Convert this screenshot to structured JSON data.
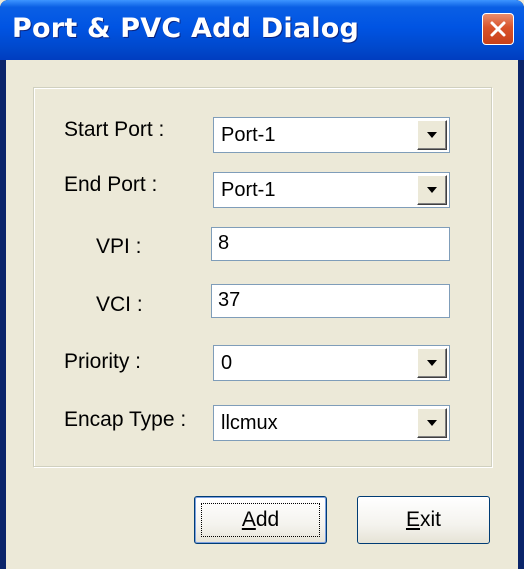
{
  "window": {
    "title": "Port & PVC Add Dialog"
  },
  "form": {
    "start_port": {
      "label": "Start Port :",
      "value": "Port-1"
    },
    "end_port": {
      "label": "End Port :",
      "value": "Port-1"
    },
    "vpi": {
      "label": "VPI :",
      "value": "8"
    },
    "vci": {
      "label": "VCI :",
      "value": "37"
    },
    "priority": {
      "label": "Priority :",
      "value": "0"
    },
    "encap_type": {
      "label": "Encap Type :",
      "value": "llcmux"
    }
  },
  "buttons": {
    "add": {
      "label": "Add",
      "mnemonic": "A",
      "rest": "dd"
    },
    "exit": {
      "label": "Exit",
      "mnemonic": "E",
      "rest": "xit"
    }
  },
  "icons": {
    "close": "close-icon",
    "dropdown": "chevron-down-icon"
  },
  "colors": {
    "titlebar": "#0054e3",
    "close_button": "#d9532a",
    "dialog_background": "#ece9d8",
    "field_border": "#7f9db9"
  }
}
